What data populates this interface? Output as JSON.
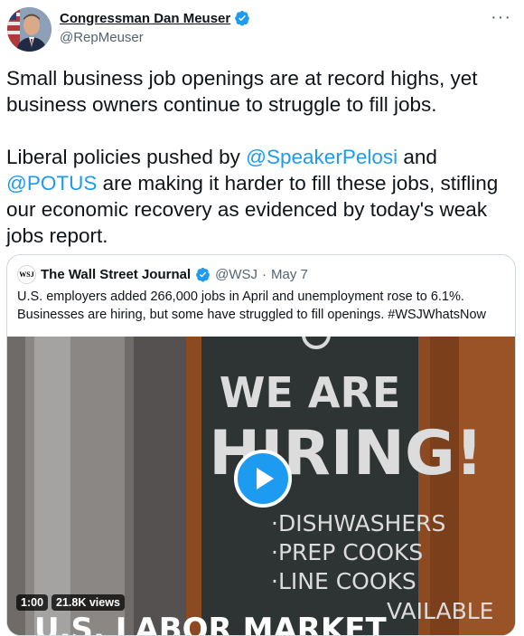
{
  "author": {
    "name": "Congressman Dan Meuser",
    "handle": "@RepMeuser"
  },
  "tweet": {
    "para1": "Small business job openings are at record highs, yet business owners continue to struggle to fill jobs.",
    "para2_prefix": "Liberal policies pushed by ",
    "mention1": "@SpeakerPelosi",
    "para2_mid": " and",
    "mention2": "@POTUS",
    "para2_suffix": " are making it harder to fill these jobs, stifling our economic recovery as evidenced by today's weak jobs report."
  },
  "quoted": {
    "logo_text": "WSJ",
    "name": "The Wall Street Journal",
    "handle": "@WSJ",
    "sep": "·",
    "date": "May 7",
    "text": "U.S. employers added 266,000 jobs in April and unemployment rose to 6.1%. Businesses are hiring, but some have struggled to fill openings. #WSJWhatsNow",
    "media": {
      "sign_line1": "WE ARE",
      "sign_line2": "HIRING!",
      "item1": "·DISHWASHERS",
      "item2": "·PREP COOKS",
      "item3": "·LINE COOKS",
      "item4": "VAILABLE",
      "banner": "U.S. LABOR MARKET",
      "duration": "1:00",
      "views": "21.8K views"
    }
  },
  "icons": {
    "verified": "verified-badge-icon",
    "more": "more-icon",
    "play": "play-icon"
  },
  "colors": {
    "accent": "#1d9bf0",
    "text": "#0f1419",
    "muted": "#536471",
    "border": "#cfd9de"
  }
}
